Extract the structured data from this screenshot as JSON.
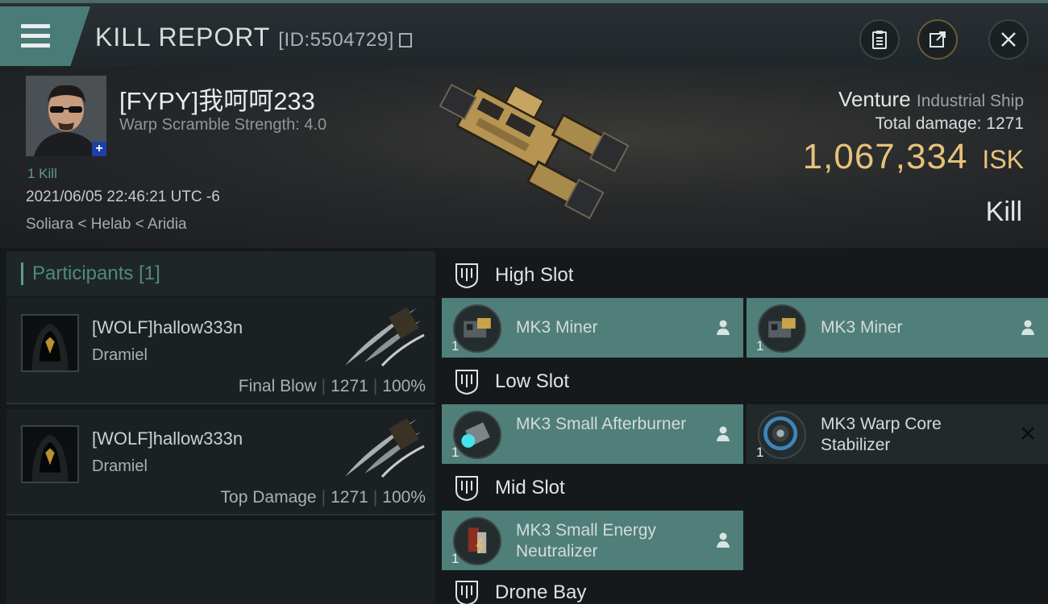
{
  "header": {
    "title": "KILL REPORT",
    "report_id": "[ID:5504729]"
  },
  "victim": {
    "name": "[FYPY]我呵呵233",
    "warp_scramble": "Warp Scramble Strength: 4.0",
    "kills": "1 Kill",
    "timestamp": "2021/06/05 22:46:21 UTC -6",
    "location": "Soliara < Helab < Aridia",
    "ship_name": "Venture",
    "ship_class": "Industrial Ship",
    "total_damage_label": "Total damage:",
    "total_damage": "1271",
    "isk_value": "1,067,334",
    "isk_unit": "ISK",
    "type": "Kill"
  },
  "participants": {
    "heading": "Participants",
    "count": "[1]",
    "rows": [
      {
        "name": "[WOLF]hallow333n",
        "ship": "Dramiel",
        "role": "Final Blow",
        "damage": "1271",
        "percent": "100%"
      },
      {
        "name": "[WOLF]hallow333n",
        "ship": "Dramiel",
        "role": "Top Damage",
        "damage": "1271",
        "percent": "100%"
      }
    ]
  },
  "slots": {
    "high": {
      "title": "High Slot",
      "modules": [
        {
          "name": "MK3 Miner",
          "qty": "1",
          "state": "dropped"
        },
        {
          "name": "MK3 Miner",
          "qty": "1",
          "state": "dropped"
        }
      ]
    },
    "low": {
      "title": "Low Slot",
      "modules": [
        {
          "name": "MK3 Small Afterburner",
          "qty": "1",
          "state": "dropped"
        },
        {
          "name": "MK3 Warp Core Stabilizer",
          "qty": "1",
          "state": "destroyed"
        }
      ]
    },
    "mid": {
      "title": "Mid Slot",
      "modules": [
        {
          "name": "MK3 Small Energy Neutralizer",
          "qty": "1",
          "state": "dropped"
        }
      ]
    },
    "drone": {
      "title": "Drone Bay"
    }
  },
  "colors": {
    "accent": "#4f7f78",
    "isk": "#e6c27a",
    "header_tab": "#4a7c77"
  },
  "icons": [
    "menu-icon",
    "copy-icon",
    "clipboard-icon",
    "share-icon",
    "close-icon",
    "shield-slot-icon",
    "person-icon",
    "x-icon"
  ]
}
